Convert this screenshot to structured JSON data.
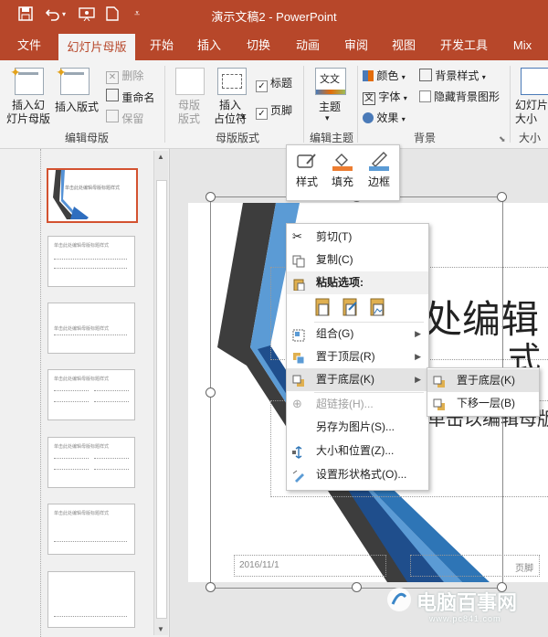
{
  "titlebar": {
    "title": "演示文稿2  -  PowerPoint",
    "save_icon": "save-icon",
    "undo_icon": "undo-icon",
    "present_icon": "present-icon",
    "new_icon": "new-file-icon",
    "customize_icon": "customize-icon",
    "color": "#b7472a"
  },
  "tabs": [
    {
      "label": "文件"
    },
    {
      "label": "幻灯片母版"
    },
    {
      "label": "开始"
    },
    {
      "label": "插入"
    },
    {
      "label": "切换"
    },
    {
      "label": "动画"
    },
    {
      "label": "审阅"
    },
    {
      "label": "视图"
    },
    {
      "label": "开发工具"
    },
    {
      "label": "Mix"
    }
  ],
  "ribbon": {
    "insert_master": "插入幻\n灯片母版",
    "insert_layout": "插入版式",
    "delete": "删除",
    "rename": "重命名",
    "preserve": "保留",
    "group_edit_master": "编辑母版",
    "master_layout": "母版\n版式",
    "insert_placeholder": "插入\n占位符",
    "placeholder_caret": "▾",
    "title_check": "标题",
    "footer_check": "页脚",
    "group_master_layout": "母版版式",
    "theme": "主题",
    "group_edit_theme": "编辑主题",
    "colors": "颜色",
    "fonts": "字体",
    "effects": "效果",
    "bg_style": "背景样式",
    "hide_bg": "隐藏背景图形",
    "group_background": "背景",
    "slide_size": "幻灯片\n大小",
    "group_size": "大小"
  },
  "minitoolbar": {
    "style": "样式",
    "fill": "填充",
    "outline": "边框"
  },
  "context_menu": {
    "cut": "剪切(T)",
    "copy": "复制(C)",
    "paste_options": "粘贴选项:",
    "group": "组合(G)",
    "bring_front": "置于顶层(R)",
    "send_back": "置于底层(K)",
    "hyperlink": "超链接(H)...",
    "save_picture": "另存为图片(S)...",
    "size_position": "大小和位置(Z)...",
    "format_shape": "设置形状格式(O)..."
  },
  "submenu": {
    "send_to_back": "置于底层(K)",
    "send_backward": "下移一层(B)"
  },
  "slide": {
    "title_text": "处编辑",
    "title_text2": "式",
    "subtitle_text": "单击以编辑母版副",
    "date": "2016/11/1",
    "footer": "页脚"
  },
  "thumb_titles": [
    "单击此处编辑母版标题样式",
    "单击此处编辑母版标题样式",
    "单击此处编辑母版标题样式",
    "单击此处编辑母版标题样式",
    "单击此处编辑母版标题样式",
    "单击此处编辑母版标题样式",
    ""
  ],
  "watermark": {
    "brand": "电脑百事网",
    "url": "www.pc841.com"
  }
}
